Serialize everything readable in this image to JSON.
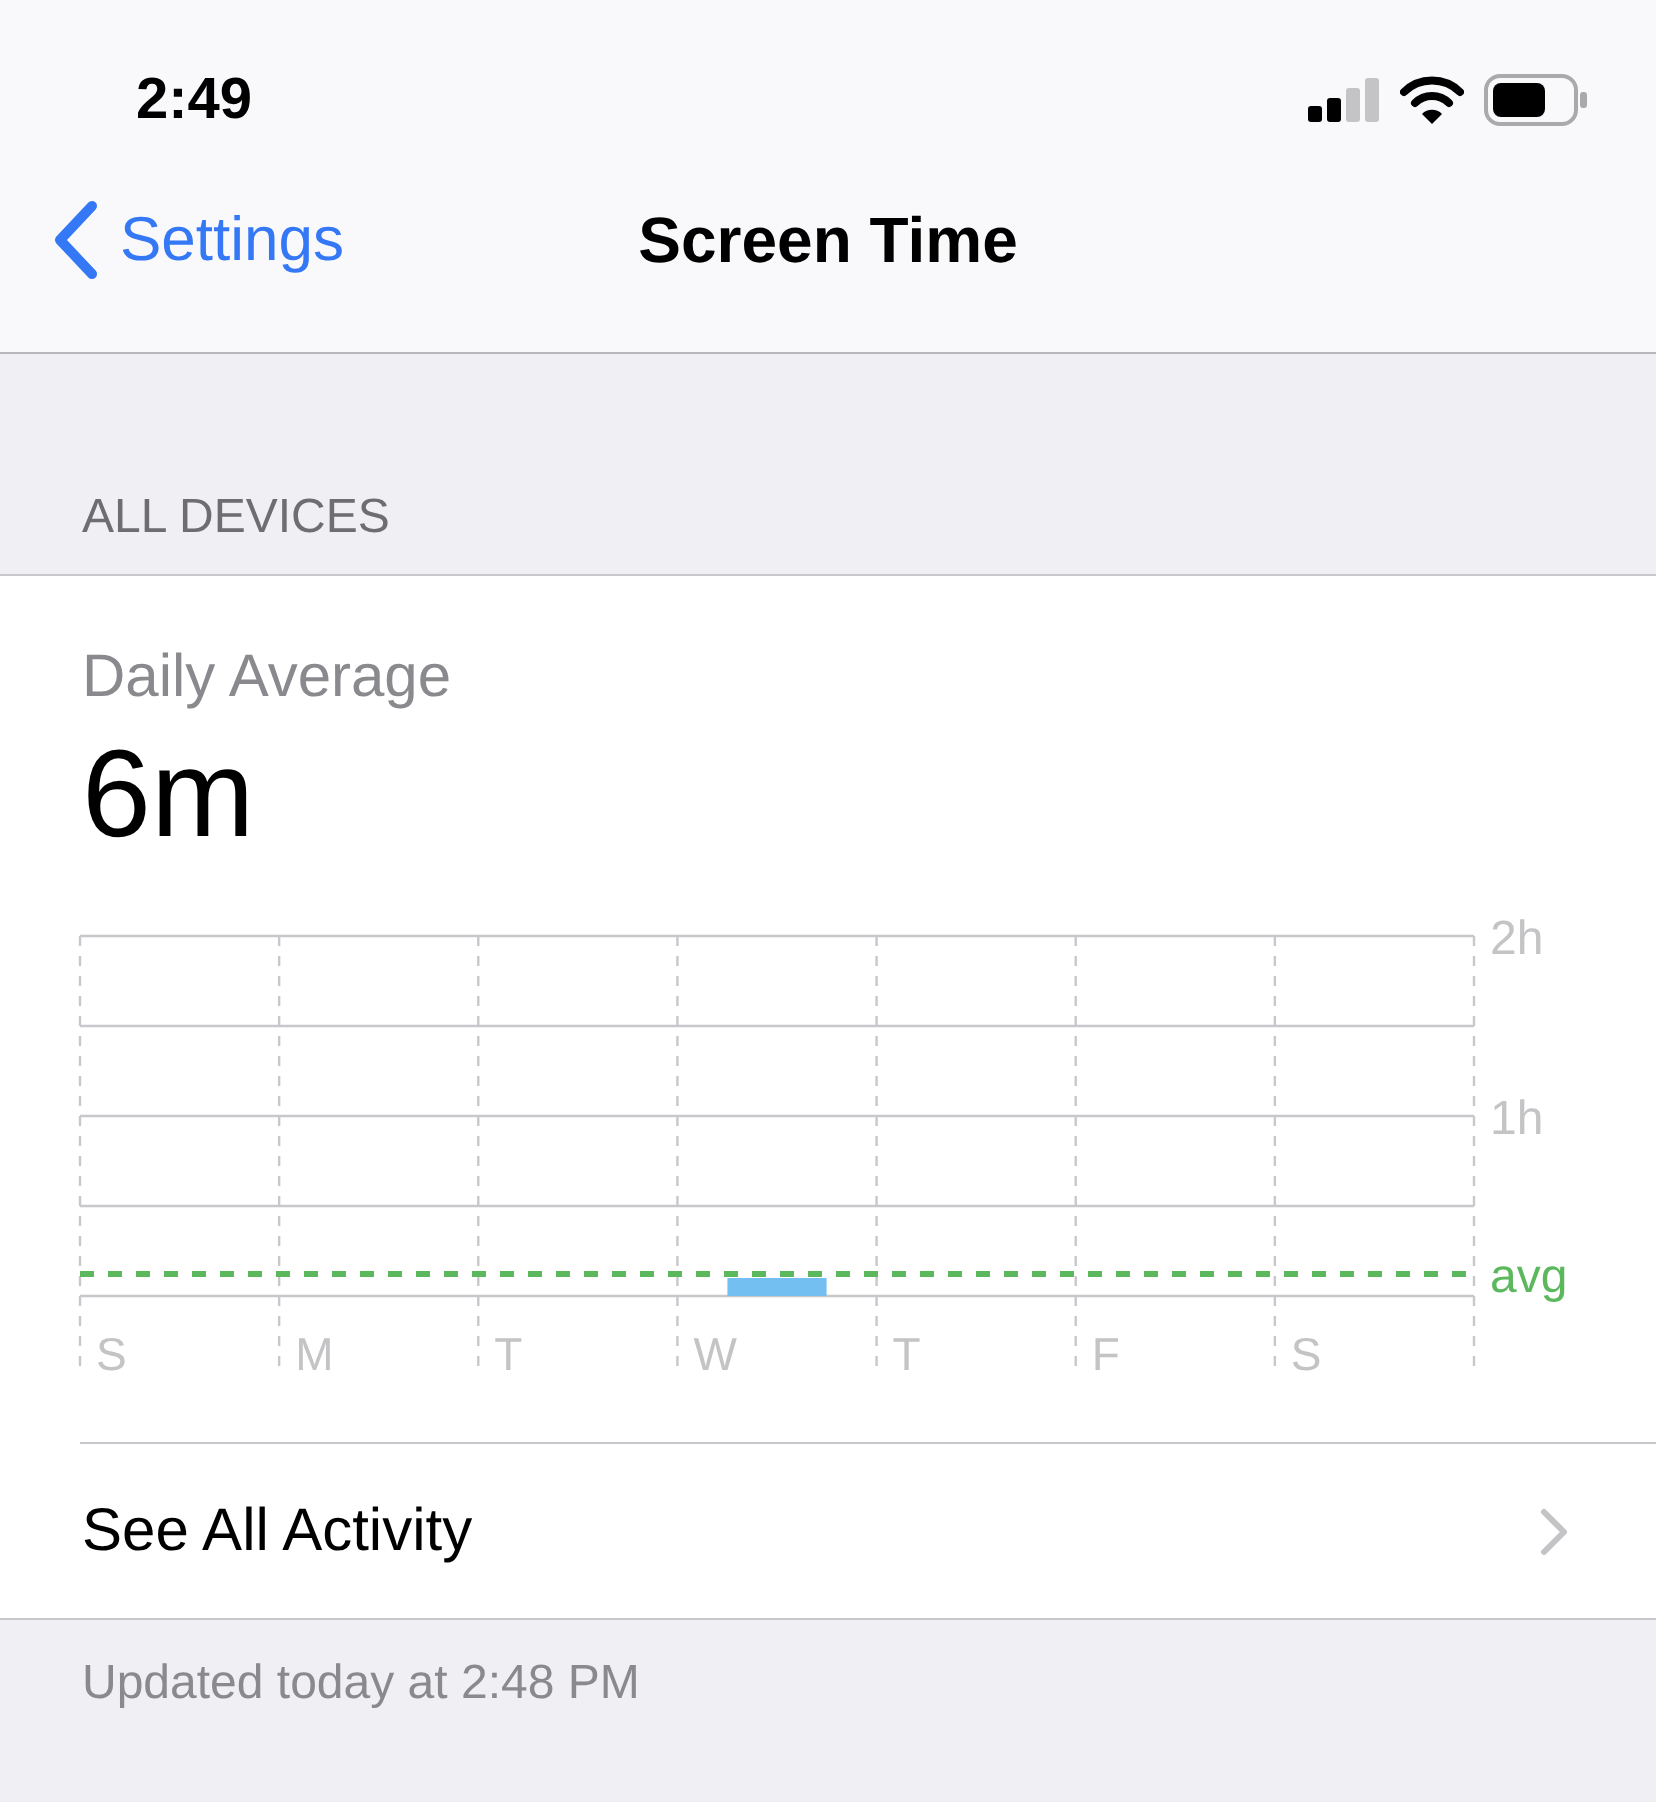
{
  "status_bar": {
    "time": "2:49"
  },
  "nav": {
    "back": "Settings",
    "title": "Screen Time"
  },
  "section_header": "ALL DEVICES",
  "summary": {
    "label": "Daily Average",
    "value": "6m"
  },
  "chart_data": {
    "type": "bar",
    "categories": [
      "S",
      "M",
      "T",
      "W",
      "T",
      "F",
      "S"
    ],
    "series": [
      {
        "color": "#74bff2",
        "values": [
          0,
          0,
          0,
          0.1,
          0,
          0,
          0
        ]
      }
    ],
    "ylim": [
      0,
      2
    ],
    "yticks": [
      {
        "value": 1,
        "label": "1h"
      },
      {
        "value": 2,
        "label": "2h"
      }
    ]
  },
  "average_label": "avg",
  "link": {
    "label": "See All Activity"
  },
  "footer": "Updated today at 2:48 PM"
}
